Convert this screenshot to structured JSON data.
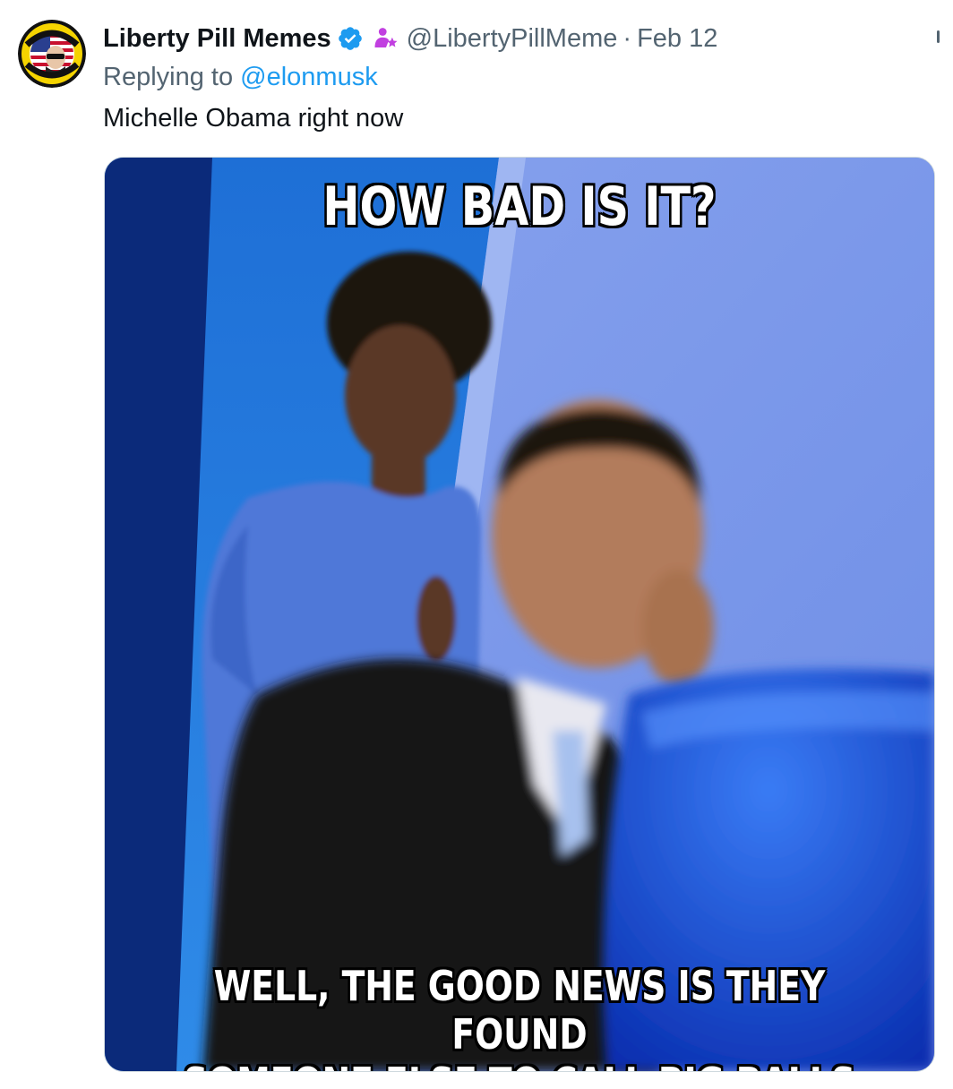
{
  "tweet": {
    "author": {
      "display_name": "Liberty Pill Memes",
      "handle": "@LibertyPillMeme",
      "verified": true,
      "avatar_text_top": "I SUPPORT",
      "avatar_text_bottom": "CRITICAL THINKING"
    },
    "separator": "·",
    "date": "Feb 12",
    "replying_prefix": "Replying to",
    "replying_to": "@elonmusk",
    "text": "Michelle Obama right now",
    "media": {
      "caption_top": "HOW BAD IS IT?",
      "caption_bottom_line1": "WELL, THE GOOD NEWS IS THEY FOUND",
      "caption_bottom_line2": "SOMEONE ELSE TO CALL BIG BALLS"
    }
  },
  "colors": {
    "text_primary": "#0f1419",
    "text_secondary": "#536471",
    "link": "#1d9bf0",
    "verified_badge": "#1d9bf0",
    "affiliate_badge": "#c13fe0"
  },
  "icons": {
    "verified": "verified-badge-icon",
    "affiliate": "affiliate-person-star-icon",
    "more": "more-options-icon"
  }
}
